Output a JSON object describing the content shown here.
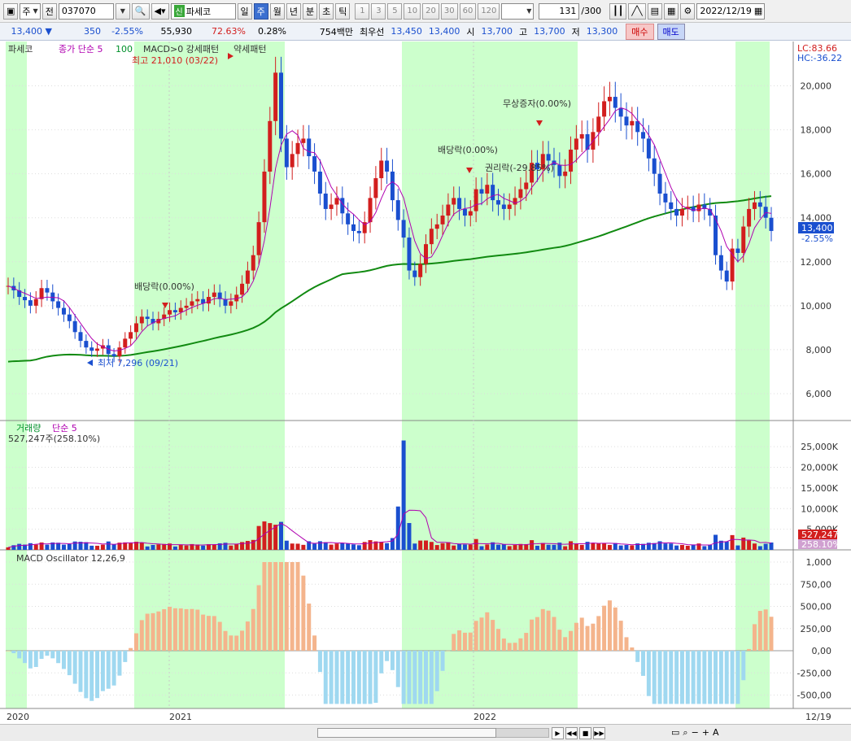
{
  "toolbar": {
    "type_label": "주",
    "prefix_label": "전",
    "code_value": "037070",
    "badge": "신",
    "stock_name": "파세코",
    "periods": [
      "일",
      "주",
      "월",
      "년",
      "분",
      "초",
      "틱"
    ],
    "active_period": "주",
    "ranges": [
      "1",
      "3",
      "5",
      "10",
      "20",
      "30",
      "60",
      "120"
    ],
    "count": "131",
    "count_total": "/300",
    "date": "2022/12/19"
  },
  "quote": {
    "price": "13,400",
    "change": "350",
    "change_pct": "-2.55%",
    "volume": "55,930",
    "vol_ratio": "72.63%",
    "turnover": "0.28%",
    "amount": "754백만",
    "best_label": "최우선",
    "ask": "13,450",
    "bid": "13,400",
    "open_label": "시",
    "open": "13,700",
    "high_label": "고",
    "high": "13,700",
    "low_label": "저",
    "low": "13,300",
    "buy_label": "매수",
    "sell_label": "매도"
  },
  "price_panel": {
    "name": "파세코",
    "ma_label": "종가 단순 5",
    "ma2_label": "100",
    "pattern_label": "MACD>0 강세패턴",
    "pattern2_label": "약세패턴",
    "lc": "LC:83.66",
    "hc": "HC:-36.22",
    "last_price_label": "13,400",
    "last_change_label": "-2.55%",
    "annotations": {
      "high": "최고 21,010 (03/22)",
      "low": "최저 7,296 (09/21)",
      "div1": "배당락(0.00%)",
      "div2": "배당락(0.00%)",
      "rights": "권리락(-29.85%)",
      "bonus": "무상증자(0.00%)"
    }
  },
  "volume_panel": {
    "title": "거래량",
    "ma_label": "단순 5",
    "value_label": "527,247주(258.10%)",
    "last_vol_label": "527,247",
    "last_vol_pct": "258.10%"
  },
  "macd_panel": {
    "title": "MACD Oscillator 12,26,9"
  },
  "x_axis": {
    "labels": [
      "2020",
      "2021",
      "2022"
    ],
    "right_label": "12/19"
  },
  "chart_data": {
    "type": "candlestick",
    "price_axis": {
      "ticks": [
        6000,
        8000,
        10000,
        12000,
        14000,
        16000,
        18000,
        20000
      ]
    },
    "volume_axis": {
      "ticks": [
        "5,000K",
        "10,000K",
        "15,000K",
        "20,000K",
        "25,000K"
      ]
    },
    "macd_axis": {
      "ticks": [
        "1,000",
        "750,00",
        "500,00",
        "250,00",
        "0,00",
        "-250,00",
        "-500,00"
      ]
    },
    "last_close": 13400,
    "closes": [
      10900,
      10700,
      10400,
      10250,
      10000,
      10300,
      10800,
      10600,
      10200,
      9900,
      9600,
      9300,
      8800,
      8400,
      8100,
      7950,
      8050,
      8200,
      7800,
      7700,
      8100,
      8500,
      8800,
      9200,
      9500,
      9400,
      9200,
      9400,
      9600,
      9800,
      9700,
      9900,
      10000,
      10200,
      10300,
      10100,
      10400,
      10600,
      10300,
      10000,
      10200,
      10500,
      11000,
      11600,
      12300,
      13800,
      16100,
      18400,
      20600,
      17600,
      16300,
      16900,
      17400,
      17600,
      16800,
      16100,
      15100,
      14400,
      14600,
      14900,
      14200,
      13700,
      13400,
      13300,
      13800,
      14900,
      15800,
      16600,
      16100,
      14800,
      13900,
      13100,
      11600,
      11300,
      11900,
      12800,
      13500,
      13700,
      14100,
      14600,
      14900,
      14400,
      14100,
      14300,
      15300,
      15100,
      15500,
      14800,
      14600,
      14400,
      14600,
      14900,
      15300,
      15600,
      16500,
      16200,
      16900,
      16600,
      16400,
      15900,
      16100,
      17100,
      17600,
      17800,
      17100,
      17900,
      18600,
      19300,
      19500,
      19000,
      18600,
      18200,
      18400,
      17900,
      17600,
      16700,
      16000,
      15100,
      14700,
      14400,
      14100,
      14400,
      14500,
      14300,
      14600,
      14400,
      14100,
      12300,
      11600,
      11100,
      12600,
      12400,
      13600,
      14400,
      14700,
      14500,
      14000,
      13400
    ]
  }
}
